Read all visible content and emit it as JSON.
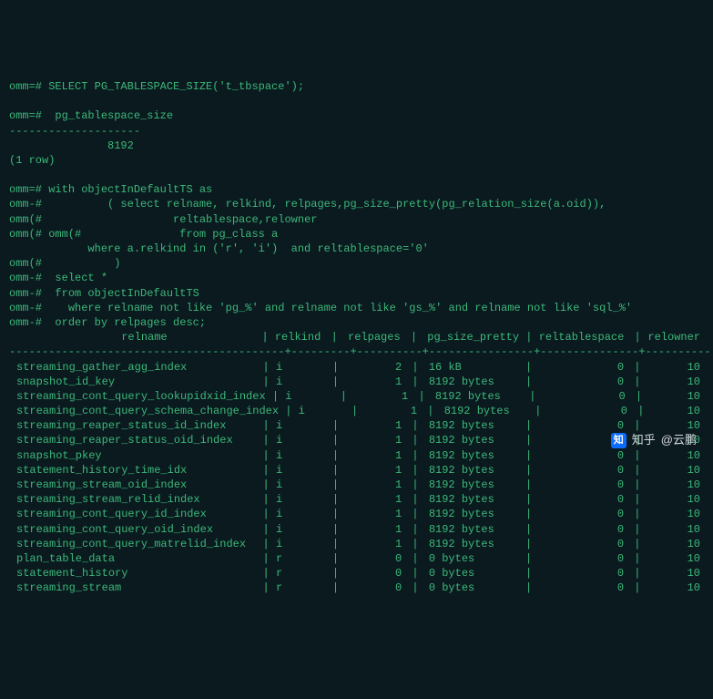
{
  "query1": {
    "prompt": "omm=#",
    "sql": "SELECT PG_TABLESPACE_SIZE('t_tbspace');",
    "col_header": " pg_tablespace_size",
    "divider": "--------------------",
    "value": "               8192",
    "rowcount": "(1 row)"
  },
  "query2": {
    "lines": [
      {
        "p": "omm=#",
        "t": " with objectInDefaultTS as"
      },
      {
        "p": "omm-#",
        "t": "          ( select relname, relkind, relpages,pg_size_pretty(pg_relation_size(a.oid)),"
      },
      {
        "p": "omm(#",
        "t": "                    reltablespace,relowner"
      },
      {
        "p": "omm(# omm(#",
        "t": "               from pg_class a"
      },
      {
        "p": "",
        "t": "            where a.relkind in ('r', 'i')  and reltablespace='0'"
      },
      {
        "p": "omm(#",
        "t": "           )"
      },
      {
        "p": "omm-#",
        "t": "  select *"
      },
      {
        "p": "omm-#",
        "t": "  from objectInDefaultTS"
      },
      {
        "p": "omm-#",
        "t": "    where relname not like 'pg_%' and relname not like 'gs_%' and relname not like 'sql_%'"
      },
      {
        "p": "omm-#",
        "t": "  order by relpages desc;"
      }
    ]
  },
  "table": {
    "headers": {
      "relname": "                relname",
      "relkind": "relkind",
      "relpages": "relpages",
      "pg_size_pretty": "pg_size_pretty",
      "reltablespace": "reltablespace",
      "relowner": "relowner"
    },
    "rows": [
      {
        "relname": "streaming_gather_agg_index",
        "relkind": "i",
        "relpages": "2",
        "size": "16 kB",
        "ts": "0",
        "owner": "10"
      },
      {
        "relname": "snapshot_id_key",
        "relkind": "i",
        "relpages": "1",
        "size": "8192 bytes",
        "ts": "0",
        "owner": "10"
      },
      {
        "relname": "streaming_cont_query_lookupidxid_index",
        "relkind": "i",
        "relpages": "1",
        "size": "8192 bytes",
        "ts": "0",
        "owner": "10"
      },
      {
        "relname": "streaming_cont_query_schema_change_index",
        "relkind": "i",
        "relpages": "1",
        "size": "8192 bytes",
        "ts": "0",
        "owner": "10"
      },
      {
        "relname": "streaming_reaper_status_id_index",
        "relkind": "i",
        "relpages": "1",
        "size": "8192 bytes",
        "ts": "0",
        "owner": "10"
      },
      {
        "relname": "streaming_reaper_status_oid_index",
        "relkind": "i",
        "relpages": "1",
        "size": "8192 bytes",
        "ts": "0",
        "owner": "10"
      },
      {
        "relname": "snapshot_pkey",
        "relkind": "i",
        "relpages": "1",
        "size": "8192 bytes",
        "ts": "0",
        "owner": "10"
      },
      {
        "relname": "statement_history_time_idx",
        "relkind": "i",
        "relpages": "1",
        "size": "8192 bytes",
        "ts": "0",
        "owner": "10"
      },
      {
        "relname": "streaming_stream_oid_index",
        "relkind": "i",
        "relpages": "1",
        "size": "8192 bytes",
        "ts": "0",
        "owner": "10"
      },
      {
        "relname": "streaming_stream_relid_index",
        "relkind": "i",
        "relpages": "1",
        "size": "8192 bytes",
        "ts": "0",
        "owner": "10"
      },
      {
        "relname": "streaming_cont_query_id_index",
        "relkind": "i",
        "relpages": "1",
        "size": "8192 bytes",
        "ts": "0",
        "owner": "10"
      },
      {
        "relname": "streaming_cont_query_oid_index",
        "relkind": "i",
        "relpages": "1",
        "size": "8192 bytes",
        "ts": "0",
        "owner": "10"
      },
      {
        "relname": "streaming_cont_query_matrelid_index",
        "relkind": "i",
        "relpages": "1",
        "size": "8192 bytes",
        "ts": "0",
        "owner": "10"
      },
      {
        "relname": "plan_table_data",
        "relkind": "r",
        "relpages": "0",
        "size": "0 bytes",
        "ts": "0",
        "owner": "10"
      },
      {
        "relname": "statement_history",
        "relkind": "r",
        "relpages": "0",
        "size": "0 bytes",
        "ts": "0",
        "owner": "10"
      },
      {
        "relname": "streaming_stream",
        "relkind": "r",
        "relpages": "0",
        "size": "0 bytes",
        "ts": "0",
        "owner": "10"
      }
    ],
    "hline": "------------------------------------------+---------+----------+----------------+---------------+----------"
  },
  "watermark": {
    "brand": "知乎",
    "author": "@云鹏"
  }
}
